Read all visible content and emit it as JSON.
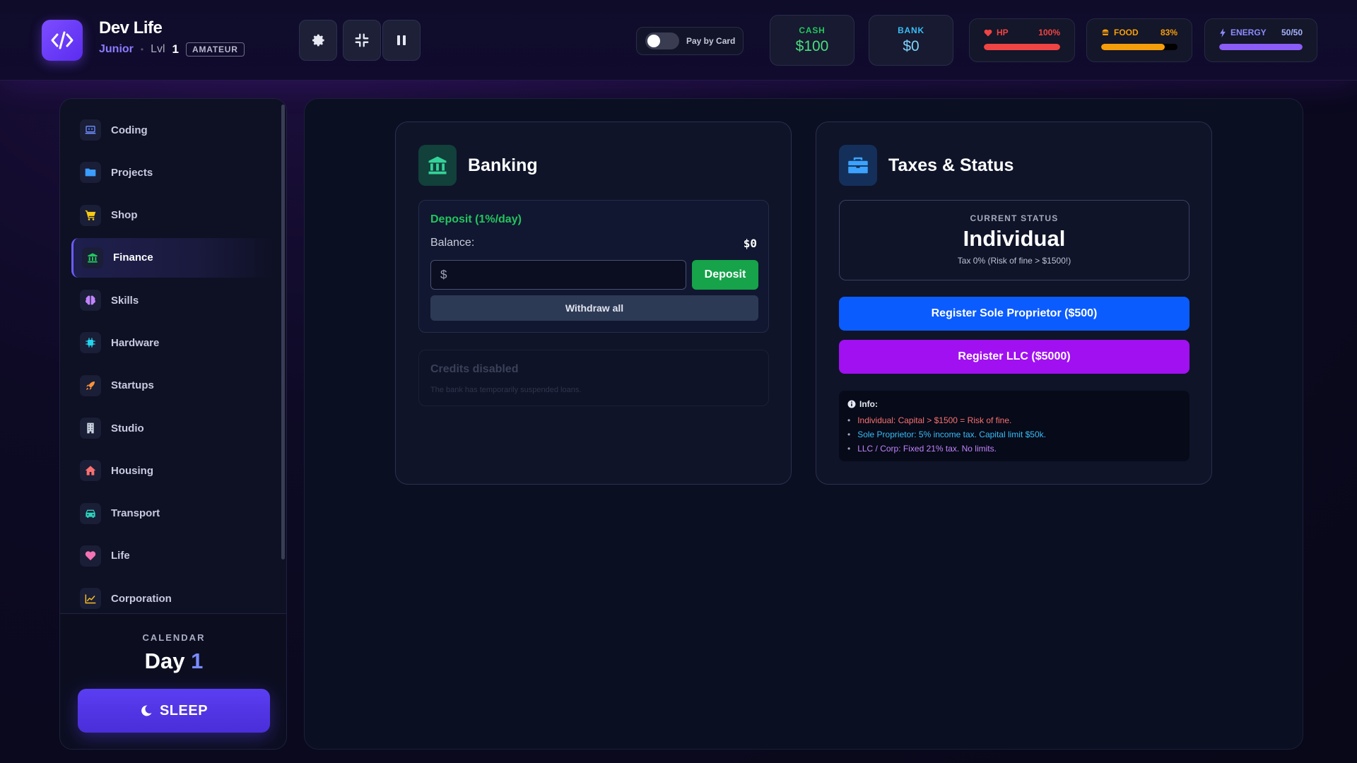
{
  "header": {
    "app_title": "Dev Life",
    "rank": "Junior",
    "separator": "•",
    "level_label": "Lvl",
    "level_value": "1",
    "tier_badge": "AMATEUR",
    "toggle_label": "Pay by Card",
    "cash": {
      "label": "CASH",
      "value": "$100",
      "color": "#22c55e"
    },
    "bank": {
      "label": "BANK",
      "value": "$0",
      "color": "#38bdf8"
    },
    "hp": {
      "label": "HP",
      "value": "100%",
      "fill": 1.0,
      "color": "#ef4444"
    },
    "food": {
      "label": "FOOD",
      "value": "83%",
      "fill": 0.83,
      "color": "#f59e0b"
    },
    "energy": {
      "label": "ENERGY",
      "value": "50/50",
      "fill": 1.0,
      "color": "#8b5cf6"
    }
  },
  "sidebar": {
    "items": [
      {
        "label": "Coding",
        "icon": "laptop-code-icon",
        "color": "#6b8cff",
        "active": false
      },
      {
        "label": "Projects",
        "icon": "folder-icon",
        "color": "#3b9dff",
        "active": false
      },
      {
        "label": "Shop",
        "icon": "cart-icon",
        "color": "#facc15",
        "active": false
      },
      {
        "label": "Finance",
        "icon": "bank-icon",
        "color": "#22c55e",
        "active": true
      },
      {
        "label": "Skills",
        "icon": "brain-icon",
        "color": "#c084fc",
        "active": false
      },
      {
        "label": "Hardware",
        "icon": "chip-icon",
        "color": "#22d3ee",
        "active": false
      },
      {
        "label": "Startups",
        "icon": "rocket-icon",
        "color": "#fb923c",
        "active": false
      },
      {
        "label": "Studio",
        "icon": "building-icon",
        "color": "#cbd5e1",
        "active": false
      },
      {
        "label": "Housing",
        "icon": "house-icon",
        "color": "#f87171",
        "active": false
      },
      {
        "label": "Transport",
        "icon": "car-icon",
        "color": "#2dd4bf",
        "active": false
      },
      {
        "label": "Life",
        "icon": "heart-icon",
        "color": "#f472b6",
        "active": false
      },
      {
        "label": "Corporation",
        "icon": "chart-line-icon",
        "color": "#fbbf24",
        "active": false
      }
    ],
    "calendar_label": "CALENDAR",
    "day_label": "Day",
    "day_value": "1",
    "sleep_label": "SLEEP"
  },
  "banking": {
    "title": "Banking",
    "deposit_title": "Deposit (1%/day)",
    "balance_label": "Balance:",
    "balance_value": "$0",
    "input_placeholder": "$",
    "deposit_button": "Deposit",
    "withdraw_button": "Withdraw all",
    "credits_title": "Credits disabled",
    "credits_sub": "The bank has temporarily suspended loans."
  },
  "taxes": {
    "title": "Taxes & Status",
    "status_label": "CURRENT STATUS",
    "status_value": "Individual",
    "status_note": "Tax 0% (Risk of fine > $1500!)",
    "register_sole": "Register Sole Proprietor ($500)",
    "register_llc": "Register LLC ($5000)",
    "info_title": "Info:",
    "info_items": [
      {
        "text": "Individual: Capital > $1500 = Risk of fine.",
        "color": "#f87171"
      },
      {
        "text": "Sole Proprietor: 5% income tax. Capital limit $50k.",
        "color": "#38bdf8"
      },
      {
        "text": "LLC / Corp: Fixed 21% tax. No limits.",
        "color": "#c084fc"
      }
    ]
  }
}
